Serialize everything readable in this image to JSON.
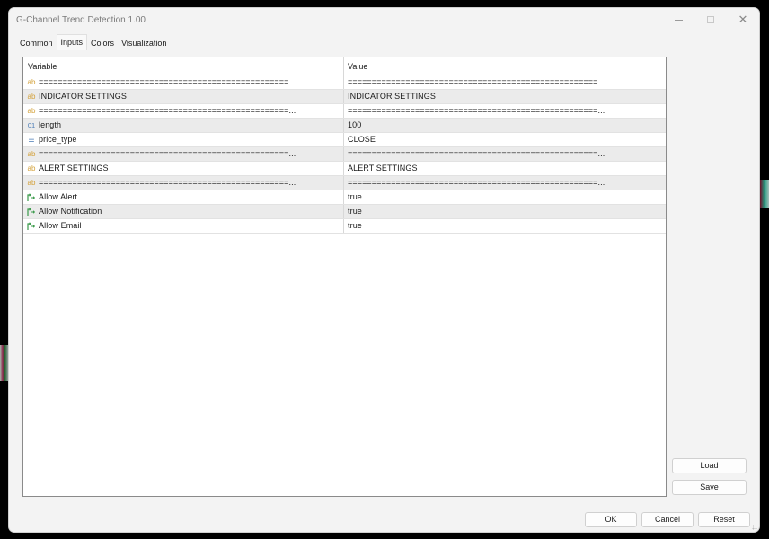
{
  "window": {
    "title": "G-Channel Trend Detection 1.00",
    "controls": {
      "minimize": "minimize-icon",
      "maximize": "maximize-icon",
      "close": "close-icon"
    }
  },
  "tabs": [
    {
      "label": "Common",
      "active": false
    },
    {
      "label": "Inputs",
      "active": true
    },
    {
      "label": "Colors",
      "active": false
    },
    {
      "label": "Visualization",
      "active": false
    }
  ],
  "grid": {
    "headers": {
      "variable": "Variable",
      "value": "Value"
    },
    "rows": [
      {
        "icon": "ab",
        "variable": "====================================================...",
        "value": "====================================================..."
      },
      {
        "icon": "ab",
        "variable": "INDICATOR  SETTINGS",
        "value": "INDICATOR  SETTINGS"
      },
      {
        "icon": "ab",
        "variable": "====================================================...",
        "value": "====================================================..."
      },
      {
        "icon": "01",
        "variable": "length",
        "value": "100"
      },
      {
        "icon": "enum",
        "variable": "price_type",
        "value": "CLOSE"
      },
      {
        "icon": "ab",
        "variable": "====================================================...",
        "value": "====================================================..."
      },
      {
        "icon": "ab",
        "variable": "ALERT  SETTINGS",
        "value": " ALERT  SETTINGS"
      },
      {
        "icon": "ab",
        "variable": "====================================================...",
        "value": "====================================================..."
      },
      {
        "icon": "bool",
        "variable": "Allow Alert",
        "value": "true"
      },
      {
        "icon": "bool",
        "variable": "Allow Notification",
        "value": "true"
      },
      {
        "icon": "bool",
        "variable": "Allow Email",
        "value": "true"
      }
    ]
  },
  "buttons": {
    "load": "Load",
    "save": "Save",
    "ok": "OK",
    "cancel": "Cancel",
    "reset": "Reset"
  },
  "icons": {
    "ab": "ab",
    "01": "01",
    "enum": "☰"
  },
  "colors": {
    "string_icon": "#d4a23c",
    "number_icon": "#4a7bb5",
    "bool_icon": "#3a9a4a"
  }
}
